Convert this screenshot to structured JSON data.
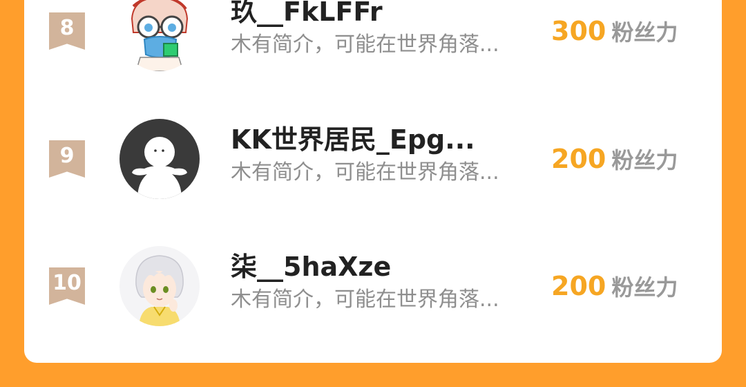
{
  "ranking": {
    "entries": [
      {
        "rank": "8",
        "name": "玖__FkLFFr",
        "bio": "木有简介，可能在世界角落...",
        "score": "300",
        "unit": "粉丝力",
        "avatar": "cartoon-boy-glasses-avatar"
      },
      {
        "rank": "9",
        "name": "KK世界居民_Epg...",
        "bio": "木有简介，可能在世界角落...",
        "score": "200",
        "unit": "粉丝力",
        "avatar": "default-dark-avatar"
      },
      {
        "rank": "10",
        "name": "柒__5haXze",
        "bio": "木有简介，可能在世界角落...",
        "score": "200",
        "unit": "粉丝力",
        "avatar": "anime-boy-avatar"
      }
    ]
  },
  "colors": {
    "background": "#FF9E2C",
    "card": "#FFFFFF",
    "rank_badge": "#D2B49B",
    "score": "#F6A623",
    "unit": "#999999",
    "bio": "#8E8E8E"
  }
}
